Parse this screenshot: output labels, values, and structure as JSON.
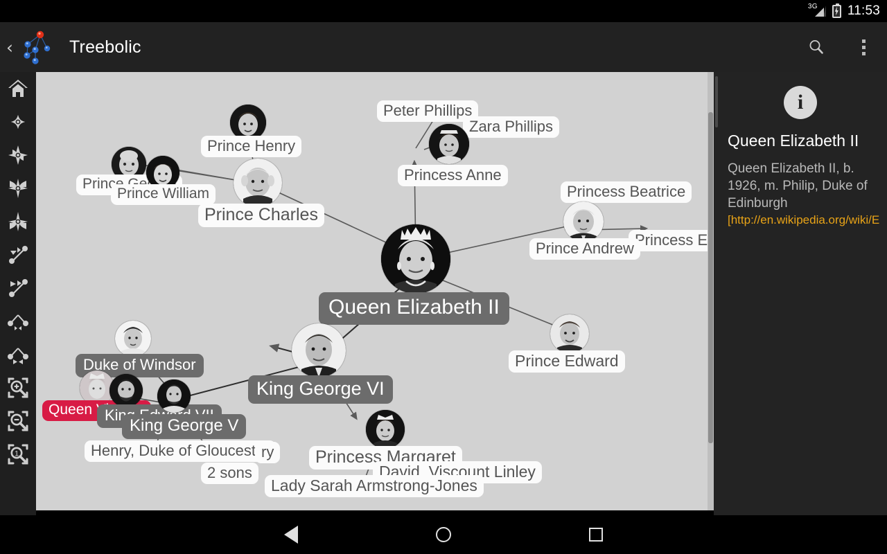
{
  "status_bar": {
    "network_label": "3G",
    "battery_icon": "battery-charging-icon",
    "clock": "11:53"
  },
  "app_bar": {
    "up_caret": "‹",
    "logo_icon": "treebolic-graph-logo",
    "title": "Treebolic",
    "actions": [
      {
        "name": "search-icon",
        "label": "Search"
      },
      {
        "name": "overflow-menu-icon",
        "label": "More options"
      }
    ]
  },
  "toolbar": {
    "items": [
      {
        "name": "home-icon",
        "label": "Home"
      },
      {
        "name": "north-compass-icon",
        "label": "Orient north"
      },
      {
        "name": "south-compass-icon",
        "label": "Orient south"
      },
      {
        "name": "east-compass-icon",
        "label": "Orient east"
      },
      {
        "name": "west-compass-icon",
        "label": "Orient west"
      },
      {
        "name": "edge-arrow-icon",
        "label": "Edge style"
      },
      {
        "name": "edge-arrow-alt-icon",
        "label": "Edge style alt"
      },
      {
        "name": "expand-tree-icon",
        "label": "Expand"
      },
      {
        "name": "collapse-tree-icon",
        "label": "Collapse"
      },
      {
        "name": "zoom-in-icon",
        "label": "Zoom in"
      },
      {
        "name": "zoom-out-icon",
        "label": "Zoom out"
      },
      {
        "name": "zoom-reset-icon",
        "label": "Reset zoom"
      }
    ]
  },
  "graph": {
    "background": "#d2d2d2",
    "root_label": "Queen Elizabeth II",
    "highlight_color": "#d81b45",
    "nodes": [
      {
        "id": "prince-george",
        "label": "Prince George",
        "style": "light"
      },
      {
        "id": "prince-william",
        "label": "Prince William",
        "style": "light"
      },
      {
        "id": "prince-henry",
        "label": "Prince Henry",
        "style": "light"
      },
      {
        "id": "prince-charles",
        "label": "Prince Charles",
        "style": "light"
      },
      {
        "id": "peter-phillips",
        "label": "Peter Phillips",
        "style": "light"
      },
      {
        "id": "zara-phillips",
        "label": "Zara Phillips",
        "style": "light"
      },
      {
        "id": "princess-anne",
        "label": "Princess Anne",
        "style": "light"
      },
      {
        "id": "princess-beatrice",
        "label": "Princess Beatrice",
        "style": "light"
      },
      {
        "id": "princess-eugenie",
        "label": "Princess Eugenie",
        "style": "light"
      },
      {
        "id": "prince-andrew",
        "label": "Prince Andrew",
        "style": "light"
      },
      {
        "id": "queen-elizabeth-ii",
        "label": "Queen Elizabeth II",
        "style": "root"
      },
      {
        "id": "prince-edward",
        "label": "Prince Edward",
        "style": "light"
      },
      {
        "id": "king-george-vi",
        "label": "King George VI",
        "style": "dark"
      },
      {
        "id": "duke-of-windsor",
        "label": "Duke of Windsor",
        "style": "dark"
      },
      {
        "id": "queen-victoria",
        "label": "Queen Victoria",
        "style": "hl"
      },
      {
        "id": "king-edward-vii",
        "label": "King Edward VII",
        "style": "dark"
      },
      {
        "id": "king-george-v",
        "label": "King George V",
        "style": "dark"
      },
      {
        "id": "henry-gloucester",
        "label": "Henry, Duke of Gloucester",
        "style": "light"
      },
      {
        "id": "canterbury-clip",
        "label": "ry",
        "style": "light"
      },
      {
        "id": "two-sons",
        "label": "2 sons",
        "style": "light"
      },
      {
        "id": "princess-margaret",
        "label": "Princess Margaret",
        "style": "light"
      },
      {
        "id": "david-linley",
        "label": "David, Viscount Linley",
        "style": "light"
      },
      {
        "id": "lady-sarah",
        "label": "Lady Sarah Armstrong-Jones",
        "style": "light"
      }
    ]
  },
  "info_panel": {
    "icon": "info-icon",
    "title": "Queen Elizabeth II",
    "body": "Queen Elizabeth II, b. 1926, m. Philip, Duke of Edinburgh",
    "link": "[http://en.wikipedia.org/wiki/E",
    "link_color": "#e8a317"
  },
  "nav_bar": {
    "back": "back-icon",
    "home": "home-icon",
    "recents": "recents-icon"
  }
}
